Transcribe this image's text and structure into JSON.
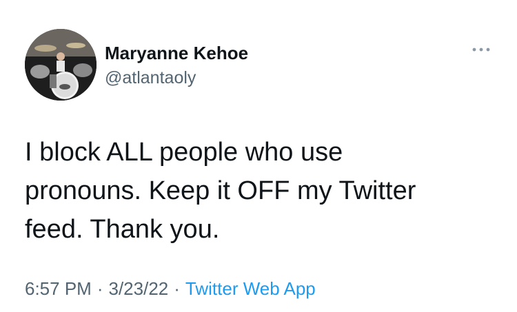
{
  "tweet": {
    "author": {
      "display_name": "Maryanne Kehoe",
      "handle": "@atlantaoly",
      "avatar_icon": "drum-kit-photo"
    },
    "more_icon": "more-options-icon",
    "text": "I block ALL people who use\npronouns. Keep it OFF my Twitter\nfeed. Thank you.",
    "time": "6:57 PM",
    "date": "3/23/22",
    "separator": "·",
    "source": "Twitter Web App"
  },
  "colors": {
    "text_primary": "#0f1419",
    "text_secondary": "#536471",
    "link": "#1d9bf0",
    "background": "#ffffff"
  }
}
